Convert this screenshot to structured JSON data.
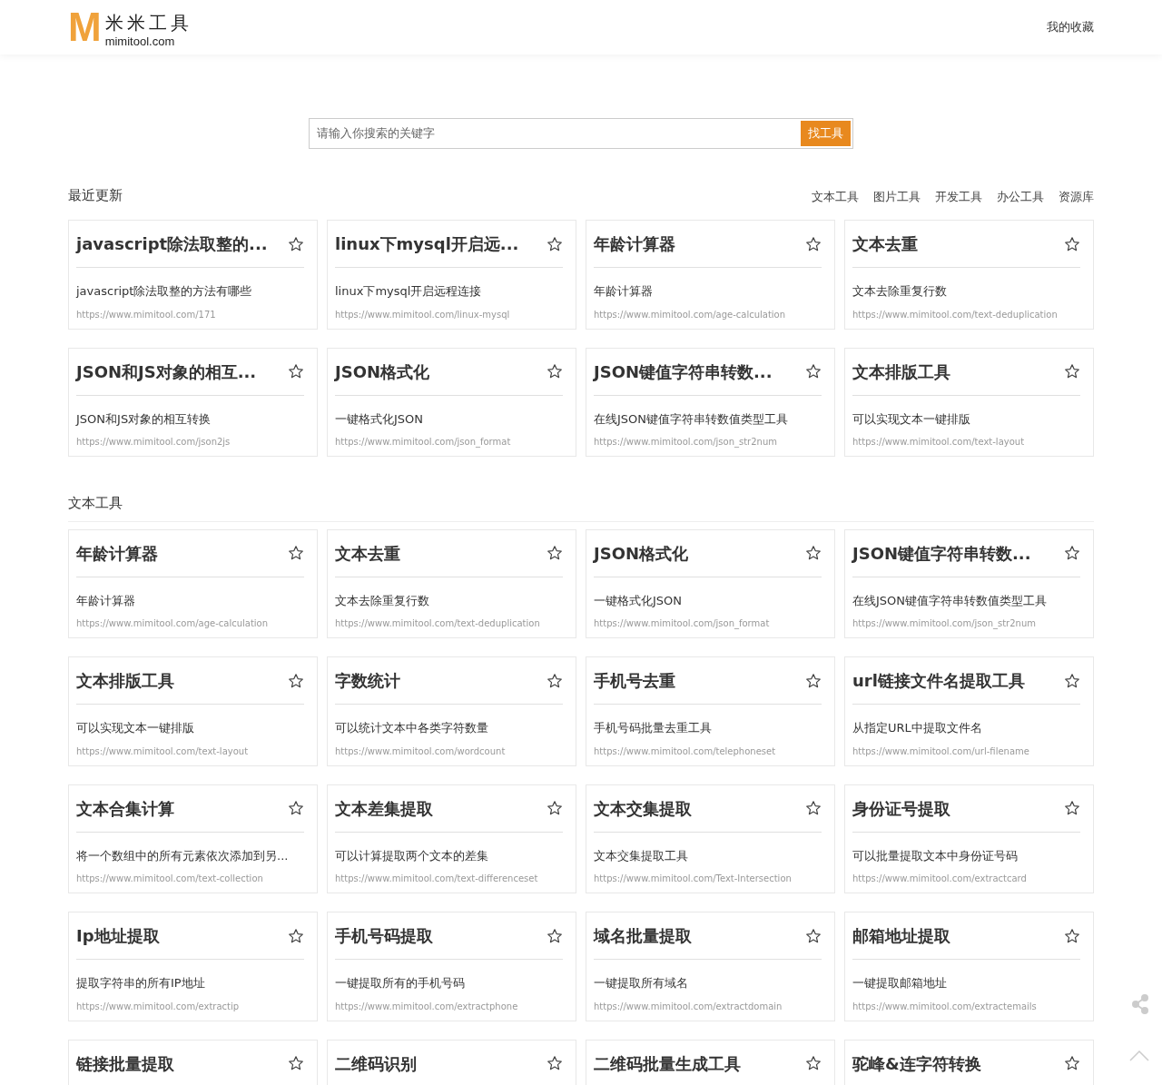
{
  "header": {
    "logo_mark": "M",
    "logo_title": "米米工具",
    "logo_domain": "mimitool.com",
    "nav_link": "我的收藏"
  },
  "search": {
    "placeholder": "请输入你搜索的关键字",
    "button": "找工具"
  },
  "sections": [
    {
      "title": "最近更新",
      "links": [
        "文本工具",
        "图片工具",
        "开发工具",
        "办公工具",
        "资源库"
      ],
      "cards": [
        {
          "title": "javascript除法取整的...",
          "description": "javascript除法取整的方法有哪些",
          "url": "https://www.mimitool.com/171"
        },
        {
          "title": "linux下mysql开启远...",
          "description": "linux下mysql开启远程连接",
          "url": "https://www.mimitool.com/linux-mysql"
        },
        {
          "title": "年龄计算器",
          "description": "年龄计算器",
          "url": "https://www.mimitool.com/age-calculation"
        },
        {
          "title": "文本去重",
          "description": "文本去除重复行数",
          "url": "https://www.mimitool.com/text-deduplication"
        },
        {
          "title": "JSON和JS对象的相互...",
          "description": "JSON和JS对象的相互转换",
          "url": "https://www.mimitool.com/json2js"
        },
        {
          "title": "JSON格式化",
          "description": "一键格式化JSON",
          "url": "https://www.mimitool.com/json_format"
        },
        {
          "title": "JSON键值字符串转数...",
          "description": "在线JSON键值字符串转数值类型工具",
          "url": "https://www.mimitool.com/json_str2num"
        },
        {
          "title": "文本排版工具",
          "description": "可以实现文本一键排版",
          "url": "https://www.mimitool.com/text-layout"
        }
      ]
    },
    {
      "title": "文本工具",
      "cards": [
        {
          "title": "年龄计算器",
          "description": "年龄计算器",
          "url": "https://www.mimitool.com/age-calculation"
        },
        {
          "title": "文本去重",
          "description": "文本去除重复行数",
          "url": "https://www.mimitool.com/text-deduplication"
        },
        {
          "title": "JSON格式化",
          "description": "一键格式化JSON",
          "url": "https://www.mimitool.com/json_format"
        },
        {
          "title": "JSON键值字符串转数...",
          "description": "在线JSON键值字符串转数值类型工具",
          "url": "https://www.mimitool.com/json_str2num"
        },
        {
          "title": "文本排版工具",
          "description": "可以实现文本一键排版",
          "url": "https://www.mimitool.com/text-layout"
        },
        {
          "title": "字数统计",
          "description": "可以统计文本中各类字符数量",
          "url": "https://www.mimitool.com/wordcount"
        },
        {
          "title": "手机号去重",
          "description": "手机号码批量去重工具",
          "url": "https://www.mimitool.com/telephoneset"
        },
        {
          "title": "url链接文件名提取工具",
          "description": "从指定URL中提取文件名",
          "url": "https://www.mimitool.com/url-filename"
        },
        {
          "title": "文本合集计算",
          "description": "将一个数组中的所有元素依次添加到另...",
          "url": "https://www.mimitool.com/text-collection"
        },
        {
          "title": "文本差集提取",
          "description": "可以计算提取两个文本的差集",
          "url": "https://www.mimitool.com/text-differenceset"
        },
        {
          "title": "文本交集提取",
          "description": "文本交集提取工具",
          "url": "https://www.mimitool.com/Text-Intersection"
        },
        {
          "title": "身份证号提取",
          "description": "可以批量提取文本中身份证号码",
          "url": "https://www.mimitool.com/extractcard"
        },
        {
          "title": "Ip地址提取",
          "description": "提取字符串的所有IP地址",
          "url": "https://www.mimitool.com/extractip"
        },
        {
          "title": "手机号码提取",
          "description": "一键提取所有的手机号码",
          "url": "https://www.mimitool.com/extractphone"
        },
        {
          "title": "域名批量提取",
          "description": "一键提取所有域名",
          "url": "https://www.mimitool.com/extractdomain"
        },
        {
          "title": "邮箱地址提取",
          "description": "一键提取邮箱地址",
          "url": "https://www.mimitool.com/extractemails"
        },
        {
          "title": "链接批量提取"
        },
        {
          "title": "二维码识别"
        },
        {
          "title": "二维码批量生成工具"
        },
        {
          "title": "驼峰&连字符转换"
        }
      ]
    }
  ]
}
